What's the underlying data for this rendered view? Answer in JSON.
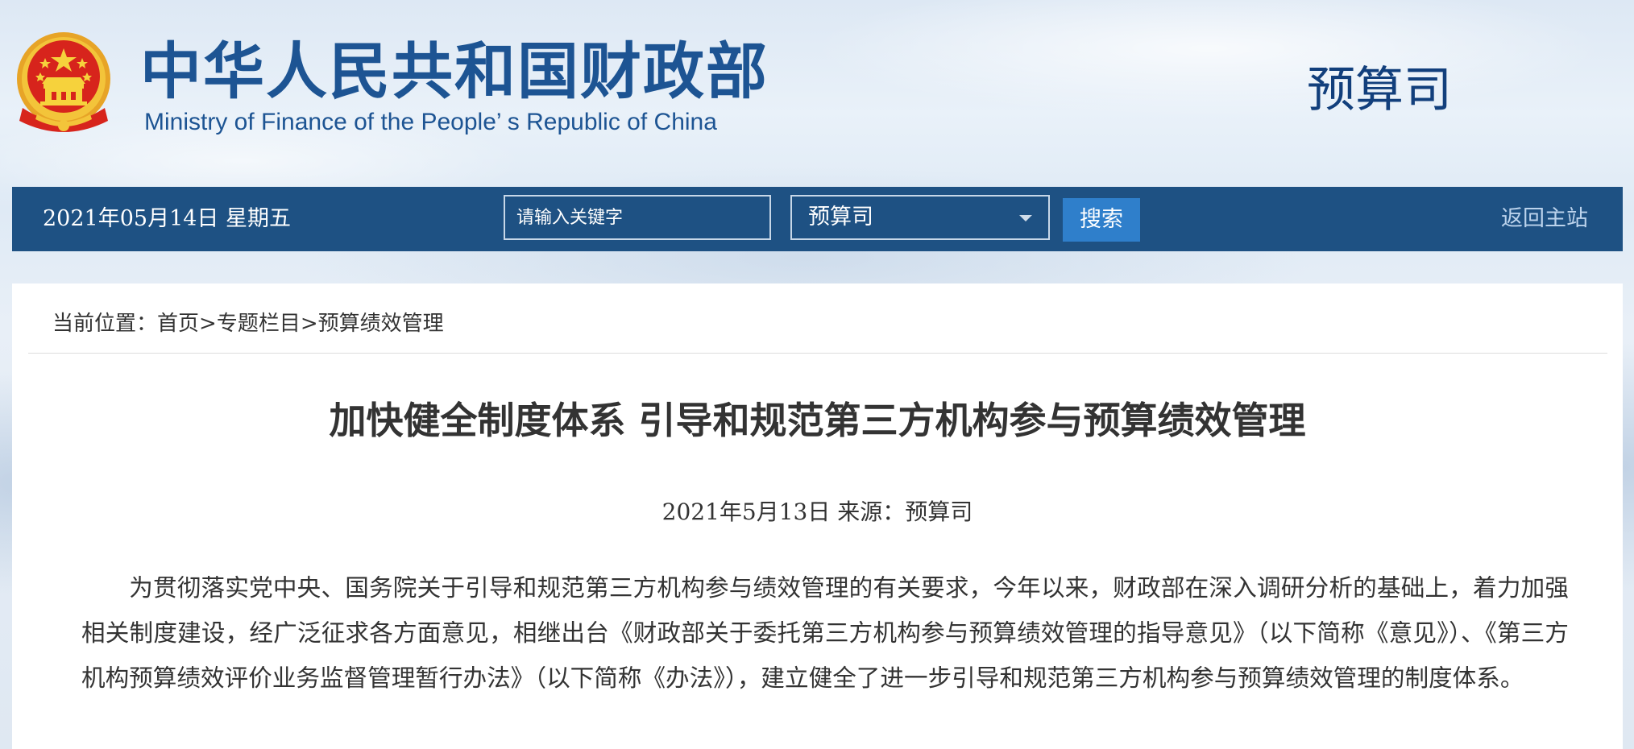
{
  "header": {
    "title_cn": "中华人民共和国财政部",
    "title_en": "Ministry of Finance of the People’ s Republic of China",
    "dept_name": "预算司",
    "emblem_icon": "national-emblem-icon"
  },
  "navbar": {
    "date": "2021年05月14日  星期五",
    "search_placeholder": "请输入关键字",
    "select_value": "预算司",
    "search_button": "搜索",
    "home_link": "返回主站"
  },
  "breadcrumb": {
    "prefix": "当前位置：",
    "items": [
      "首页",
      "专题栏目",
      "预算绩效管理"
    ],
    "separator": ">"
  },
  "article": {
    "title": "加快健全制度体系 引导和规范第三方机构参与预算绩效管理",
    "date": "2021年5月13日",
    "source_label": "来源：",
    "source": "预算司",
    "paragraph": "为贯彻落实党中央、国务院关于引导和规范第三方机构参与绩效管理的有关要求，今年以来，财政部在深入调研分析的基础上，着力加强相关制度建设，经广泛征求各方面意见，相继出台《财政部关于委托第三方机构参与预算绩效管理的指导意见》（以下简称《意见》）、《第三方机构预算绩效评价业务监督管理暂行办法》（以下简称《办法》），建立健全了进一步引导和规范第三方机构参与预算绩效管理的制度体系。"
  },
  "colors": {
    "brand_blue": "#1d5493",
    "nav_bg": "#1e5183",
    "button_bg": "#2f7fcb",
    "emblem_red": "#d7241c",
    "emblem_gold": "#f3c43a"
  }
}
